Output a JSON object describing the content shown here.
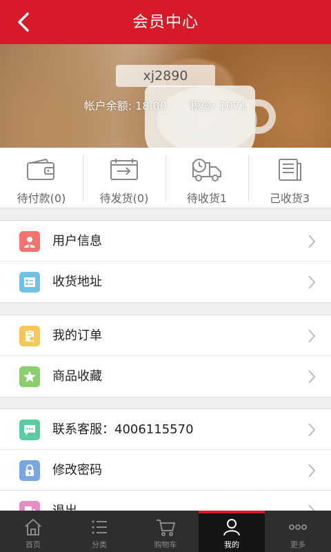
{
  "header": {
    "title": "会员中心",
    "back_icon": "chevron-left-icon"
  },
  "profile": {
    "username": "xj2890",
    "balance_text": "帐户余额: 18.00",
    "points_text": "积分: 1071"
  },
  "order_status": [
    {
      "label": "待付款(0)",
      "icon": "wallet-icon"
    },
    {
      "label": "待发货(0)",
      "icon": "box-transfer-icon"
    },
    {
      "label": "待收货1",
      "icon": "delivery-truck-icon"
    },
    {
      "label": "己收货3",
      "icon": "document-icon"
    }
  ],
  "menu_groups": [
    [
      {
        "label": "用户信息",
        "icon": "user-icon",
        "color": "#f2726e"
      },
      {
        "label": "收货地址",
        "icon": "address-card-icon",
        "color": "#6fc1e6"
      }
    ],
    [
      {
        "label": "我的订单",
        "icon": "clipboard-icon",
        "color": "#f4c95b"
      },
      {
        "label": "商品收藏",
        "icon": "star-icon",
        "color": "#8ccd6e"
      }
    ],
    [
      {
        "label": "联系客服：4006115570",
        "icon": "chat-icon",
        "color": "#5ccba0"
      },
      {
        "label": "修改密码",
        "icon": "lock-icon",
        "color": "#7aa7e3"
      },
      {
        "label": "退出",
        "icon": "logout-icon",
        "color": "#e38fc4"
      }
    ]
  ],
  "tabbar": [
    {
      "label": "首页",
      "icon": "home-icon",
      "active": false
    },
    {
      "label": "分类",
      "icon": "list-icon",
      "active": false
    },
    {
      "label": "购物车",
      "icon": "cart-icon",
      "active": false
    },
    {
      "label": "我的",
      "icon": "person-icon",
      "active": true
    },
    {
      "label": "更多",
      "icon": "more-icon",
      "active": false
    }
  ],
  "colors": {
    "brand_red": "#d7192a",
    "tabbar_bg": "#2e2e2e"
  }
}
